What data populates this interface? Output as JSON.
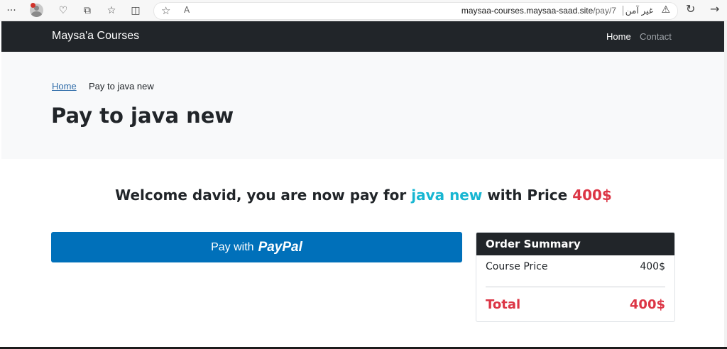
{
  "browser": {
    "url_domain": "maysaa-courses.maysaa-saad.site",
    "url_path": "/pay/7",
    "security_label": "غير آمن",
    "more_glyph": "···",
    "read_aloud_glyph": "A"
  },
  "navbar": {
    "brand": "Maysa'a Courses",
    "links": [
      "Home",
      "Contact"
    ]
  },
  "header": {
    "breadcrumb": [
      "Home",
      "Pay to java new"
    ],
    "title": "Pay to java new"
  },
  "welcome": {
    "prefix": "Welcome david, you are now pay for",
    "course": "java new",
    "middle": "with Price",
    "price": "400$"
  },
  "paypal": {
    "prefix": "Pay with",
    "brand": "PayPal"
  },
  "summary": {
    "title": "Order Summary",
    "course_price_label": "Course Price",
    "course_price_value": "400$",
    "total_label": "Total",
    "total_value": "400$"
  },
  "colors": {
    "navbar_bg": "#212529",
    "accent_course": "#17b6d2",
    "accent_price": "#dc3545",
    "paypal_blue": "#0070ba"
  }
}
